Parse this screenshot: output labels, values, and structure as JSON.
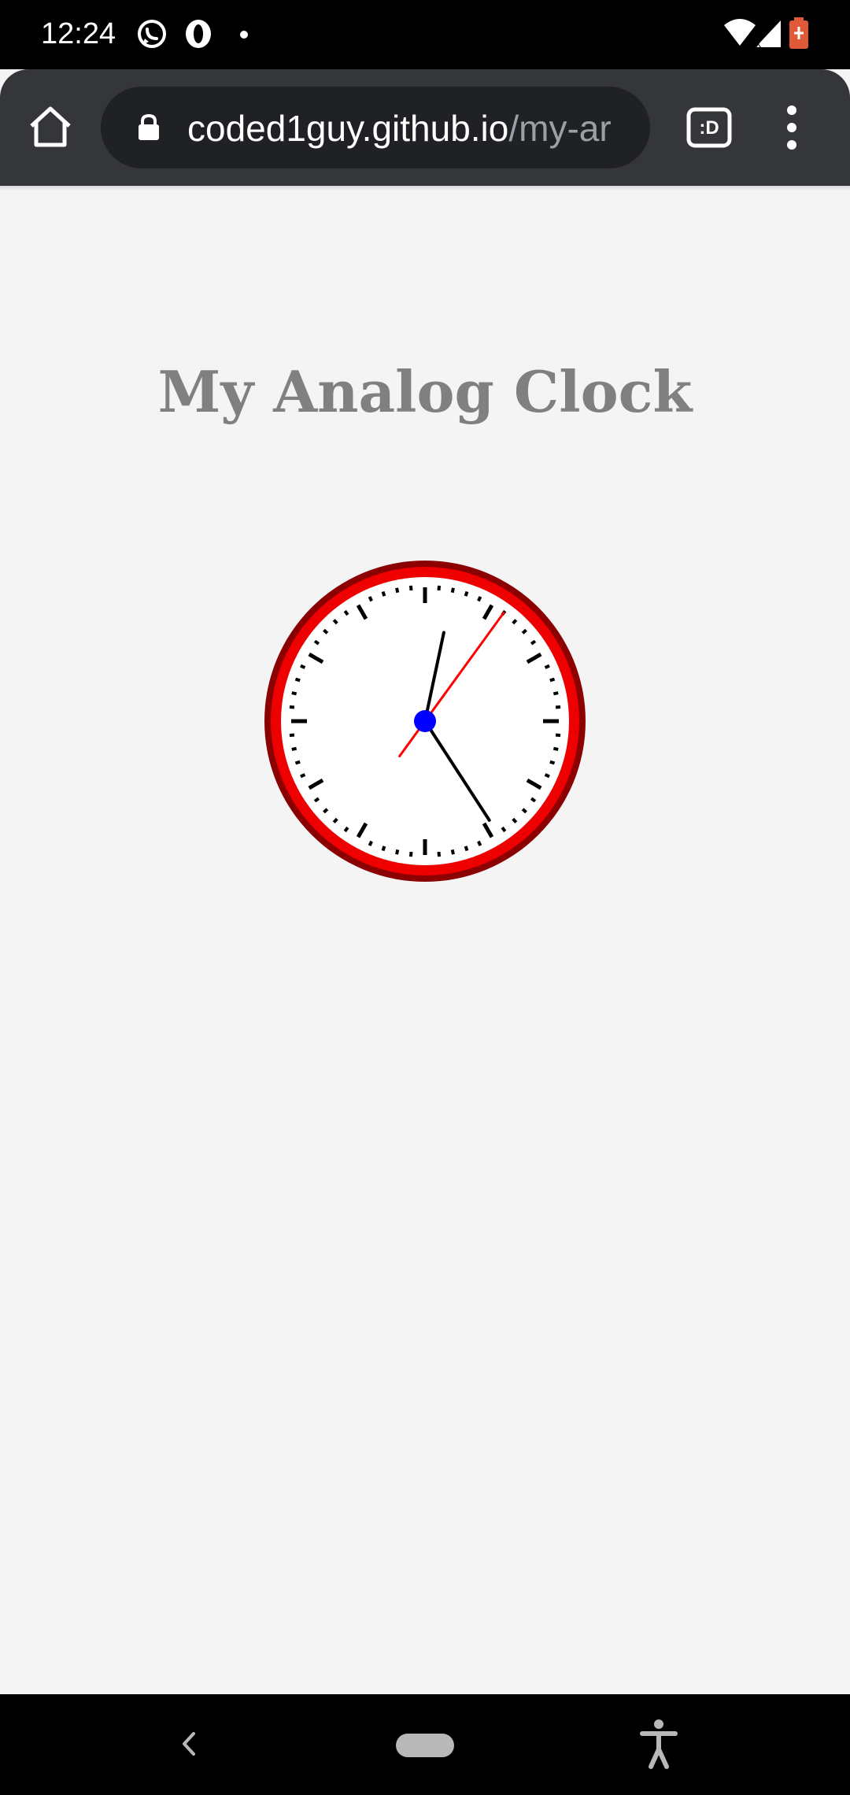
{
  "status_bar": {
    "time": "12:24",
    "icons": [
      "whatsapp-icon",
      "opera-icon",
      "dot-icon",
      "wifi-icon",
      "signal-icon",
      "battery-icon"
    ]
  },
  "browser": {
    "url_host": "coded1guy.github.io",
    "url_path": "/my-ar",
    "tab_switcher_label": ":D",
    "icons": [
      "home-icon",
      "lock-icon",
      "tab-switcher-icon",
      "overflow-menu-icon"
    ]
  },
  "page": {
    "title": "My Analog Clock"
  },
  "clock": {
    "hour": 12,
    "minute": 24,
    "second": 6,
    "colors": {
      "rim": "#ee0000",
      "rim_dark": "#8b0000",
      "face": "#ffffff",
      "hands": "#000000",
      "second_hand": "#ff0000",
      "center": "#0000ff"
    }
  },
  "nav_bar": {
    "icons": [
      "back-icon",
      "home-pill-icon",
      "accessibility-icon"
    ]
  }
}
